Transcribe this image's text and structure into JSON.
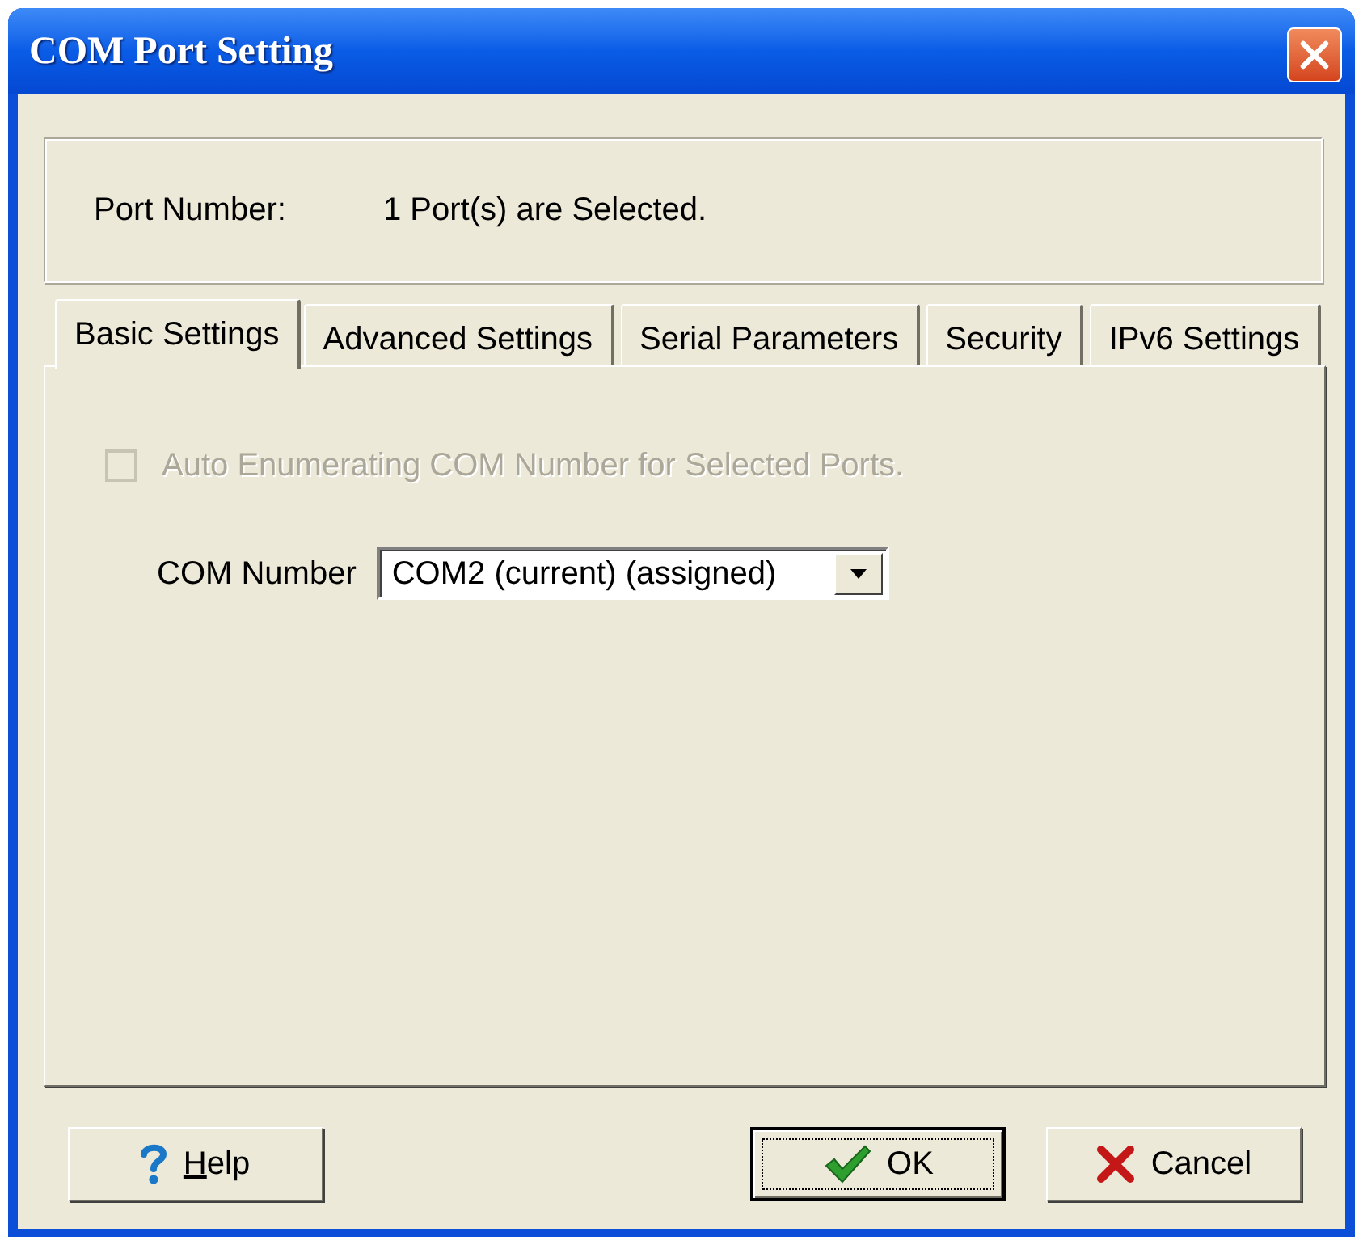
{
  "window": {
    "title": "COM Port Setting"
  },
  "port_info": {
    "label": "Port Number:",
    "value": "1 Port(s) are Selected."
  },
  "tabs": [
    {
      "label": "Basic Settings",
      "selected": true
    },
    {
      "label": "Advanced Settings",
      "selected": false
    },
    {
      "label": "Serial Parameters",
      "selected": false
    },
    {
      "label": "Security",
      "selected": false
    },
    {
      "label": "IPv6 Settings",
      "selected": false
    }
  ],
  "auto_enumerate": {
    "label": "Auto Enumerating COM Number for Selected Ports.",
    "checked": false,
    "disabled": true
  },
  "com_number": {
    "label": "COM Number",
    "value": "COM2 (current) (assigned)"
  },
  "buttons": [
    {
      "kind": "help",
      "label": "Help",
      "access_key_underlined": true,
      "default": false
    },
    {
      "kind": "ok",
      "label": "OK",
      "access_key_underlined": false,
      "default": true
    },
    {
      "kind": "cancel",
      "label": "Cancel",
      "access_key_underlined": false,
      "default": false
    }
  ]
}
